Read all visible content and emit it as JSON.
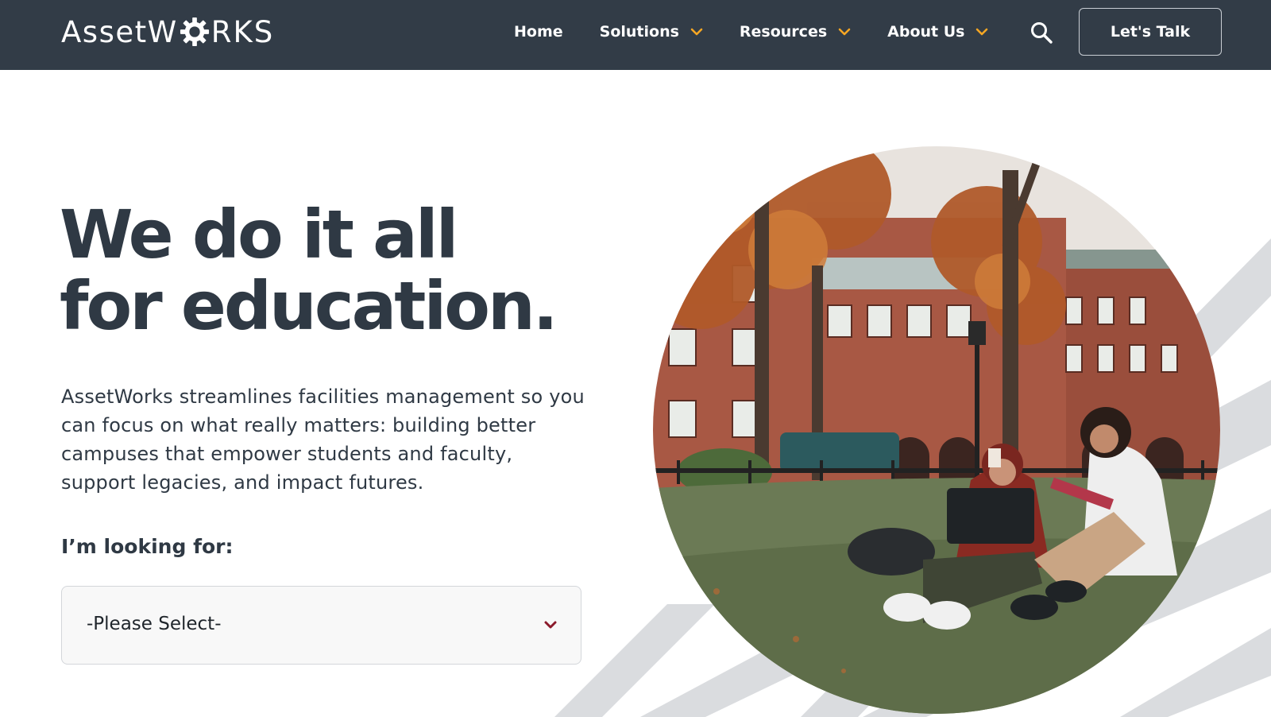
{
  "brand": {
    "logo_prefix": "AssetW",
    "logo_suffix": "RKS"
  },
  "nav": {
    "items": [
      {
        "label": "Home",
        "has_dropdown": false
      },
      {
        "label": "Solutions",
        "has_dropdown": true
      },
      {
        "label": "Resources",
        "has_dropdown": true
      },
      {
        "label": "About Us",
        "has_dropdown": true
      }
    ],
    "search_icon": "search-icon",
    "cta_label": "Let's Talk"
  },
  "hero": {
    "title_line1": "We do it all",
    "title_line2": "for education.",
    "description": "AssetWorks streamlines facilities management so you can focus on what really matters: building better campuses that empower students and faculty, support legacies, and impact futures.",
    "looking_label": "I’m looking for:",
    "select_value": "-Please Select-"
  },
  "colors": {
    "nav_bg": "#323c47",
    "accent": "#f5a623",
    "text_dark": "#2f3944",
    "select_chevron": "#8b1a2b",
    "stripe": "#d9dbde"
  }
}
